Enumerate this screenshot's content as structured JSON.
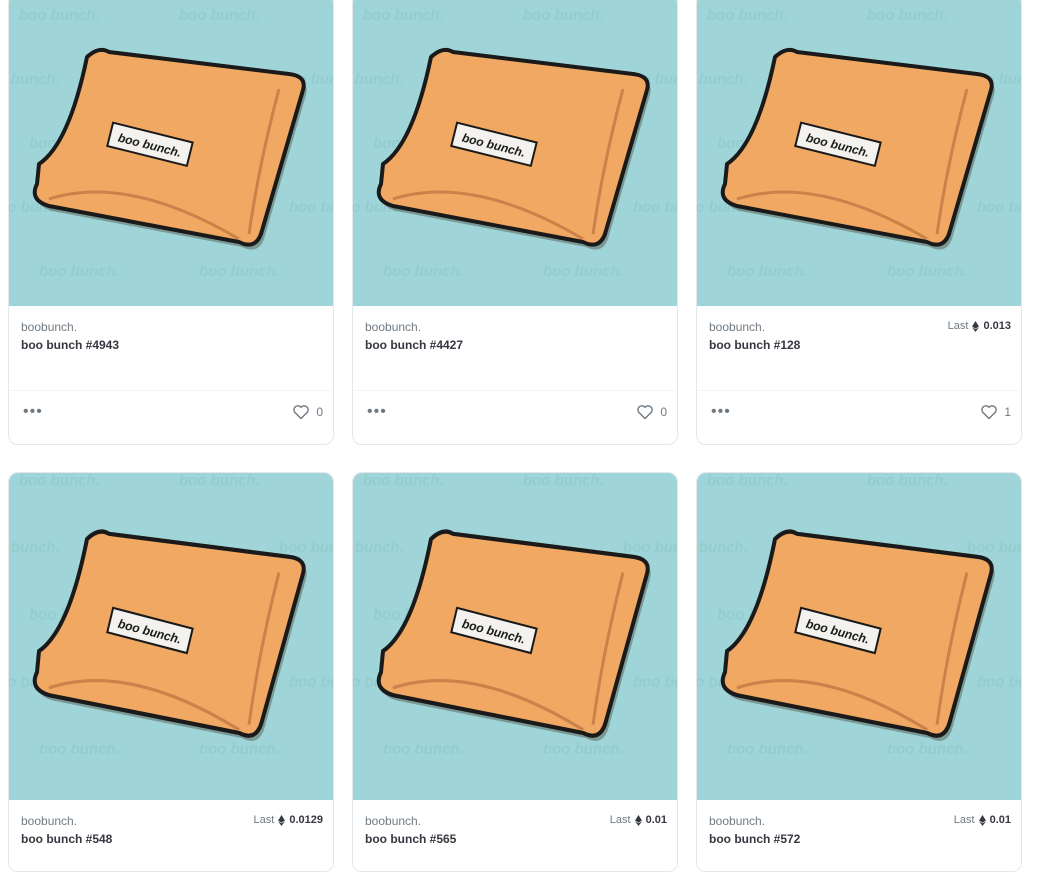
{
  "cards": [
    {
      "collection": "boobunch.",
      "name": "boo bunch #4943",
      "price_label": "",
      "price_value": "",
      "favorites": "0"
    },
    {
      "collection": "boobunch.",
      "name": "boo bunch #4427",
      "price_label": "",
      "price_value": "",
      "favorites": "0"
    },
    {
      "collection": "boobunch.",
      "name": "boo bunch #128",
      "price_label": "Last",
      "price_value": "0.013",
      "favorites": "1"
    },
    {
      "collection": "boobunch.",
      "name": "boo bunch #548",
      "price_label": "Last",
      "price_value": "0.0129"
    },
    {
      "collection": "boobunch.",
      "name": "boo bunch #565",
      "price_label": "Last",
      "price_value": "0.01"
    },
    {
      "collection": "boobunch.",
      "name": "boo bunch #572",
      "price_label": "Last",
      "price_value": "0.01"
    }
  ],
  "art": {
    "logo_text": "boo bunch.",
    "package_label": "boo bunch.",
    "background_color": "#9fd5d8",
    "package_color": "#f0a862"
  },
  "icons": {
    "more": "more-horizontal-icon",
    "favorite": "heart-outline-icon",
    "currency": "ethereum-icon"
  }
}
